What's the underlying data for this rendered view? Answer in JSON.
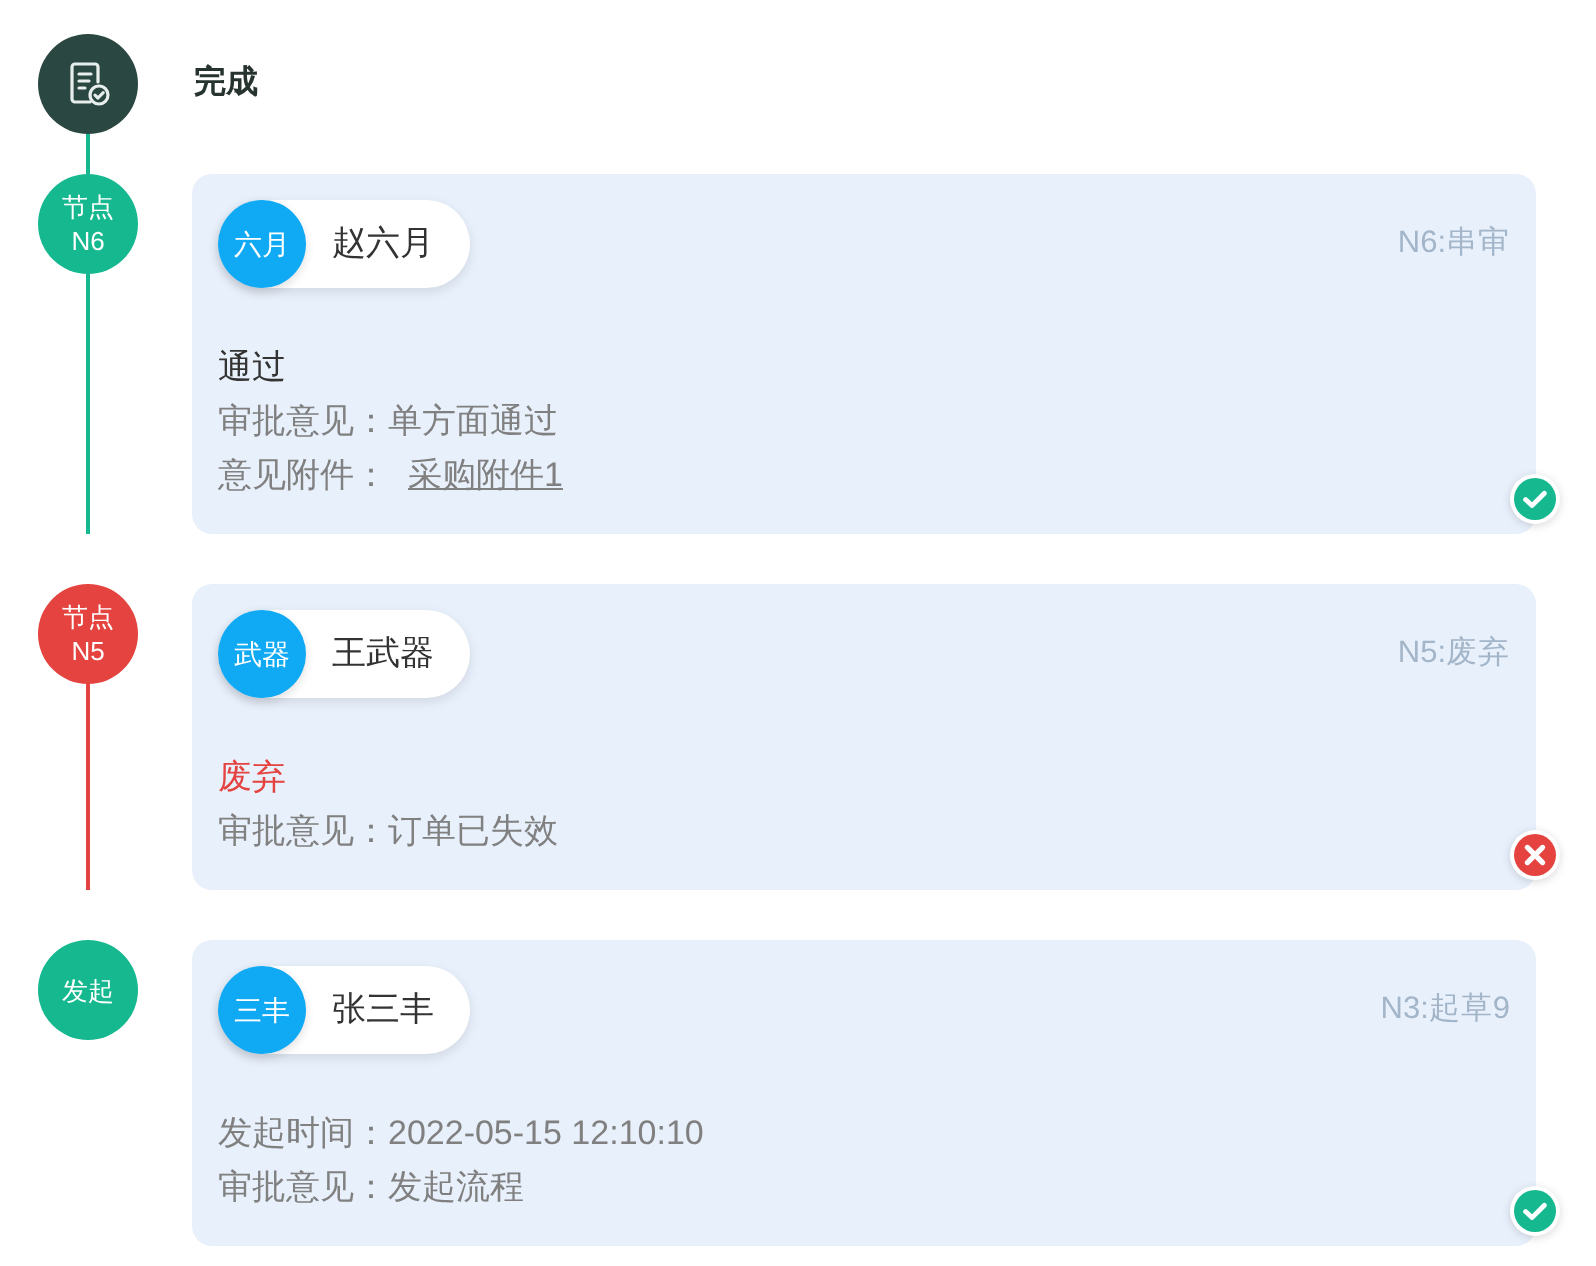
{
  "header": {
    "title": "完成"
  },
  "nodes": [
    {
      "badge": [
        "节点",
        "N6"
      ],
      "rejected": false,
      "user": {
        "avatar": "六月",
        "name": "赵六月"
      },
      "step": "N6:串审",
      "result": "通过",
      "fields": [
        {
          "kind": "text",
          "text": "审批意见：单方面通过"
        },
        {
          "kind": "attachment",
          "label": "意见附件：",
          "link": "采购附件1"
        }
      ]
    },
    {
      "badge": [
        "节点",
        "N5"
      ],
      "rejected": true,
      "user": {
        "avatar": "武器",
        "name": "王武器"
      },
      "step": "N5:废弃",
      "result": "废弃",
      "fields": [
        {
          "kind": "text",
          "text": "审批意见：订单已失效"
        }
      ]
    },
    {
      "badge": [
        "发起"
      ],
      "rejected": false,
      "user": {
        "avatar": "三丰",
        "name": "张三丰"
      },
      "step": "N3:起草9",
      "fields": [
        {
          "kind": "text",
          "text": "发起时间：2022-05-15 12:10:10"
        },
        {
          "kind": "text",
          "text": "审批意见：发起流程"
        }
      ]
    }
  ]
}
